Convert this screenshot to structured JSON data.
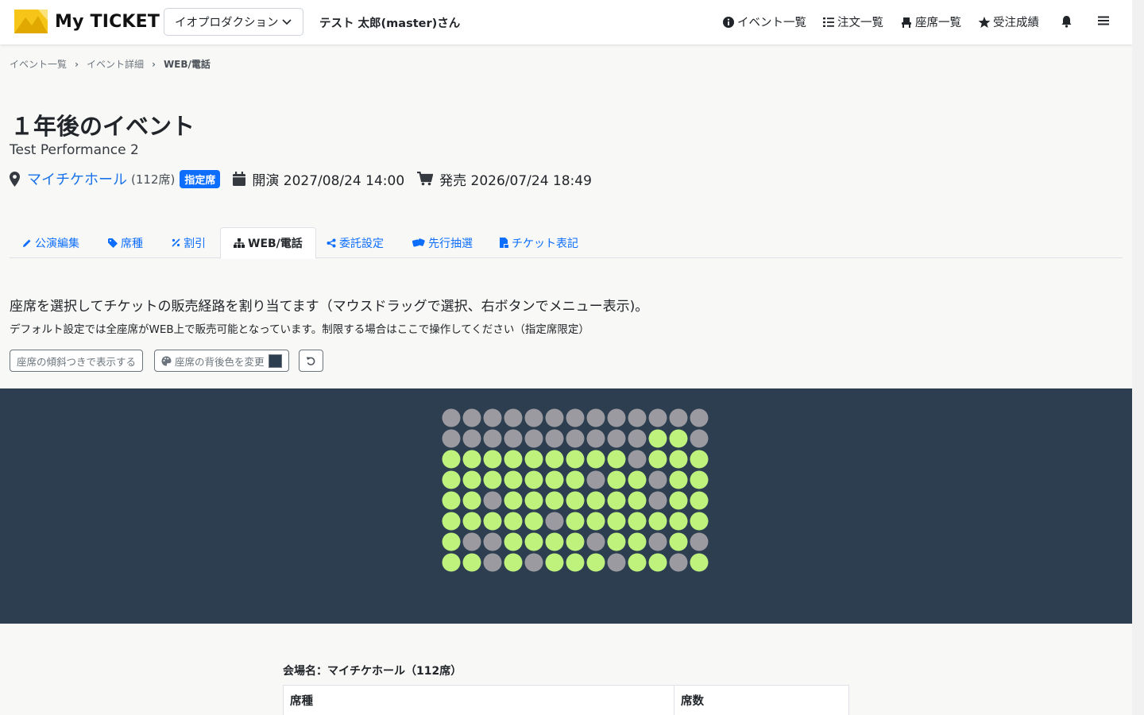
{
  "header": {
    "app_name": "My TICKET",
    "org_select": "イオプロダクション",
    "user": "テスト 太郎(master)さん",
    "nav": [
      {
        "label": "イベント一覧",
        "icon": "info-circle-icon"
      },
      {
        "label": "注文一覧",
        "icon": "list-icon"
      },
      {
        "label": "座席一覧",
        "icon": "chair-icon"
      },
      {
        "label": "受注成績",
        "icon": "star-icon"
      }
    ],
    "colors": {
      "logo_yellow": "#f5c518",
      "logo_dark": "#d4a000"
    }
  },
  "breadcrumb": [
    "イベント一覧",
    "イベント詳細",
    "WEB/電話"
  ],
  "event": {
    "title": "１年後のイベント",
    "performance": "Test Performance 2",
    "venue": "マイチケホール",
    "venue_seats": "(112席)",
    "seat_badge": "指定席",
    "open": "開演 2027/08/24 14:00",
    "sale": "発売 2026/07/24 18:49"
  },
  "tabs": [
    {
      "label": "公演編集",
      "icon": "pencil-icon",
      "active": false
    },
    {
      "label": "席種",
      "icon": "tag-icon",
      "active": false
    },
    {
      "label": "割引",
      "icon": "percent-icon",
      "active": false
    },
    {
      "label": "WEB/電話",
      "icon": "sitemap-icon",
      "active": true
    },
    {
      "label": "委託設定",
      "icon": "share-icon",
      "active": false
    },
    {
      "label": "先行抽選",
      "icon": "dice-icon",
      "active": false
    },
    {
      "label": "チケット表記",
      "icon": "file-ticket-icon",
      "active": false
    }
  ],
  "instructions": {
    "main": "座席を選択してチケットの販売経路を割り当てます（マウスドラッグで選択、右ボタンでメニュー表示)。",
    "sub": "デフォルト設定では全座席がWEB上で販売可能となっています。制限する場合はここで操作してください（指定席限定）"
  },
  "buttons": {
    "tilt": "座席の傾斜つきで表示する",
    "bg_color": "座席の背後色を変更"
  },
  "seatmap": {
    "bg_color": "#2d3e50",
    "available_color": "#bff27d",
    "unavailable_color": "#9b9aa0",
    "rows": [
      "0000000000000",
      "0000000000110",
      "1111111110111",
      "1111111011011",
      "1101111111011",
      "1111101111111",
      "1001111011010",
      "1101011101101"
    ]
  },
  "venue_table": {
    "title": "会場名：マイチケホール（112席）",
    "headers": [
      "席種",
      "席数"
    ]
  }
}
